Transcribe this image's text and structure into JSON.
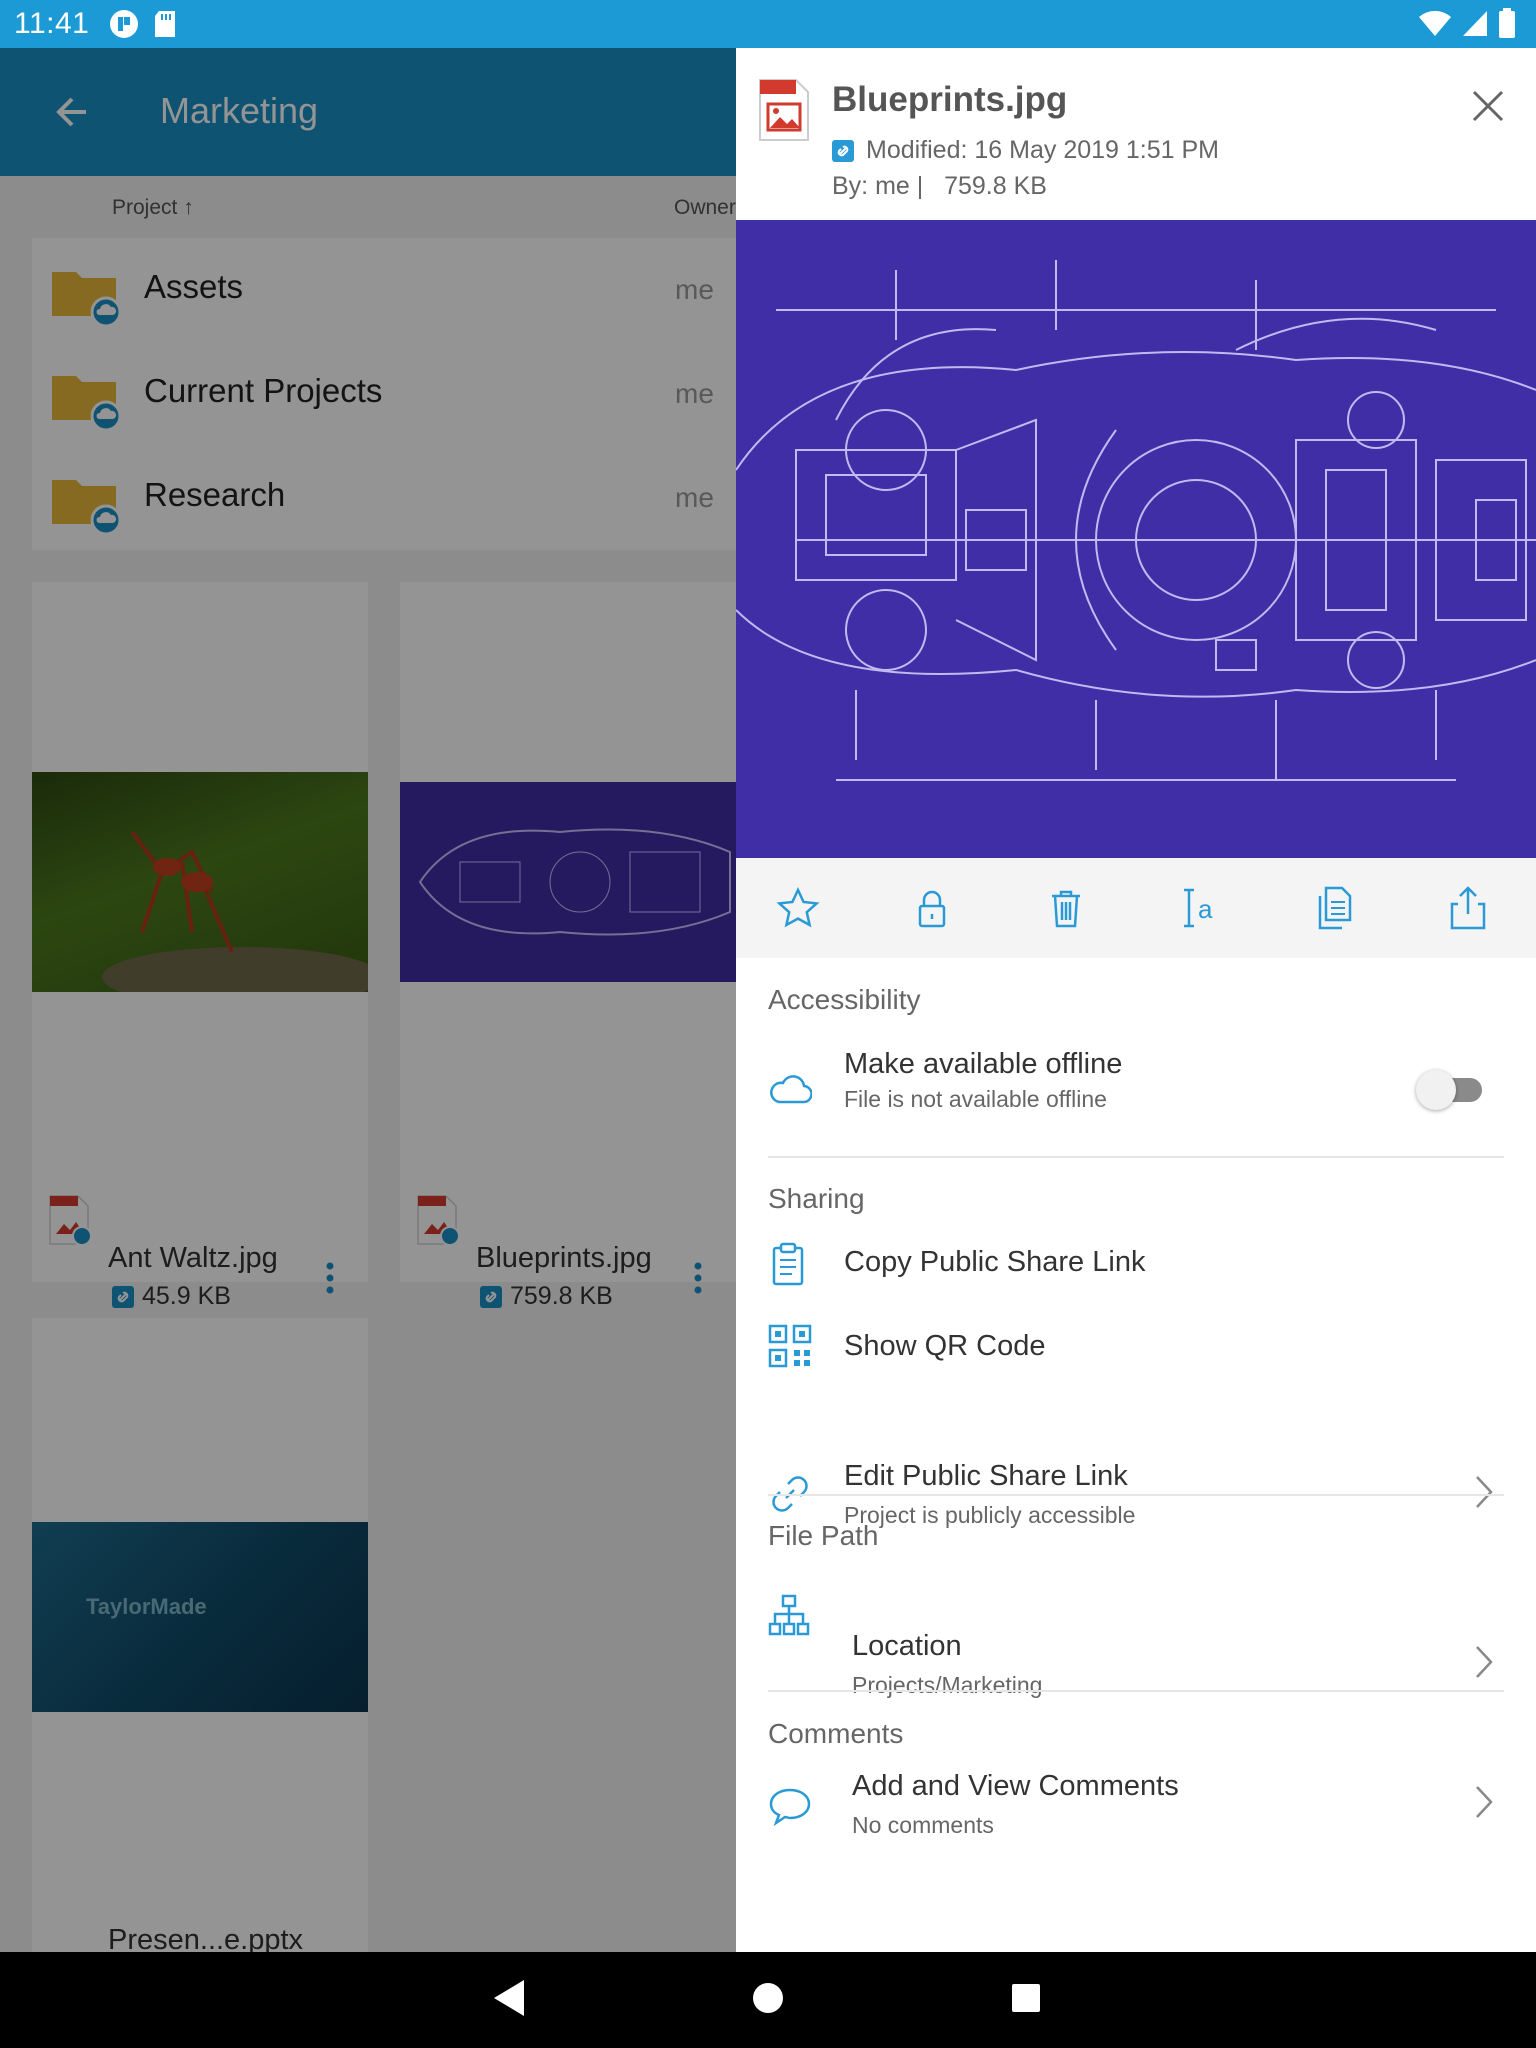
{
  "status_bar": {
    "time": "11:41"
  },
  "app_bar": {
    "title": "Marketing"
  },
  "columns": {
    "project": "Project ↑",
    "owner": "Owner"
  },
  "folders": [
    {
      "name": "Assets",
      "owner": "me"
    },
    {
      "name": "Current Projects",
      "owner": "me"
    },
    {
      "name": "Research",
      "owner": "me"
    }
  ],
  "cards": [
    {
      "name": "Ant Waltz.jpg",
      "size": "45.9 KB"
    },
    {
      "name": "Blueprints.jpg",
      "size": "759.8 KB"
    },
    {
      "name": "Presen...e.pptx",
      "thumb_text": "TaylorMade"
    }
  ],
  "panel": {
    "file_name": "Blueprints.jpg",
    "modified": "Modified: 16 May 2019 1:51 PM",
    "by": "By: me |   759.8 KB",
    "sections": {
      "accessibility": "Accessibility",
      "sharing": "Sharing",
      "file_path": "File Path",
      "comments": "Comments"
    },
    "offline": {
      "title": "Make available offline",
      "subtitle": "File is not available offline",
      "enabled": false
    },
    "copy_link": "Copy Public Share Link",
    "qr": "Show QR Code",
    "edit_link": {
      "title": "Edit Public Share Link",
      "subtitle": "Project is publicly accessible"
    },
    "location": {
      "title": "Location",
      "subtitle": "Projects/Marketing"
    },
    "comments_row": {
      "title": "Add and View Comments",
      "subtitle": "No comments"
    }
  },
  "actions": [
    "star-icon",
    "lock-icon",
    "trash-icon",
    "rename-icon",
    "copy-icon",
    "share-icon"
  ],
  "colors": {
    "accent": "#1b8fc7",
    "status_bar": "#1b9ad6",
    "blueprint": "#402ea6",
    "icon_blue": "#2a9ad6"
  }
}
